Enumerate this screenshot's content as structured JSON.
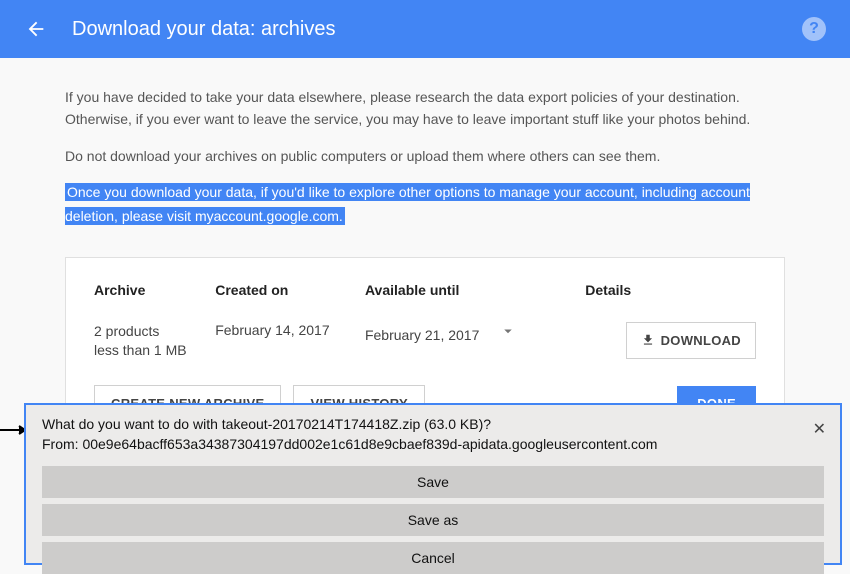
{
  "header": {
    "title": "Download your data: archives"
  },
  "intro": {
    "p1": "If you have decided to take your data elsewhere, please research the data export policies of your destination. Otherwise, if you ever want to leave the service, you may have to leave important stuff like your photos behind.",
    "p2": "Do not download your archives on public computers or upload them where others can see them.",
    "p3": "Once you download your data, if you'd like to explore other options to manage your account, including account deletion, please visit myaccount.google.com."
  },
  "table": {
    "h_archive": "Archive",
    "h_created": "Created on",
    "h_available": "Available until",
    "h_details": "Details",
    "row": {
      "archive_line1": "2 products",
      "archive_line2": "less than 1 MB",
      "created": "February 14, 2017",
      "available": "February 21, 2017"
    },
    "download_label": "DOWNLOAD"
  },
  "buttons": {
    "create": "CREATE NEW ARCHIVE",
    "history": "VIEW HISTORY",
    "done": "DONE"
  },
  "dialog": {
    "line1": "What do you want to do with takeout-20170214T174418Z.zip (63.0 KB)?",
    "line2": "From: 00e9e64bacff653a34387304197dd002e1c61d8e9cbaef839d-apidata.googleusercontent.com",
    "save": "Save",
    "saveas": "Save as",
    "cancel": "Cancel"
  }
}
